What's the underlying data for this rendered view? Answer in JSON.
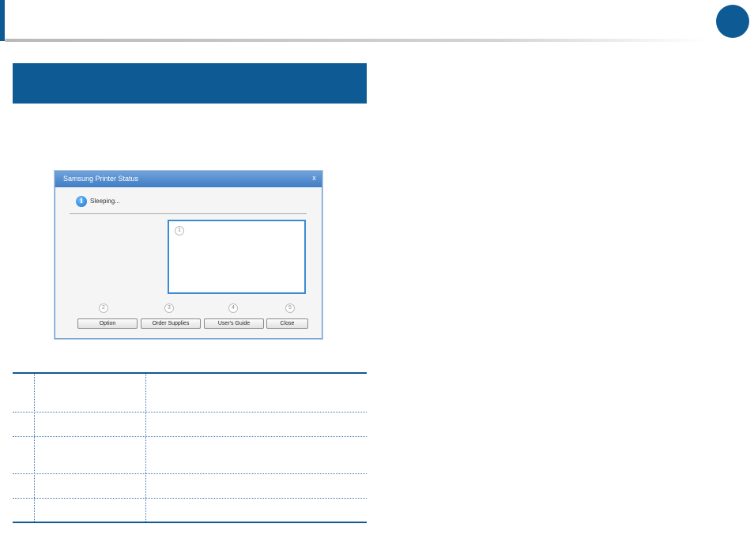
{
  "dialog": {
    "title": "Samsung Printer Status",
    "close_glyph": "x",
    "status_icon_glyph": "i",
    "status_text": "Sleeping...",
    "callouts": [
      "1",
      "2",
      "3",
      "4",
      "5"
    ],
    "buttons": {
      "option": "Option",
      "order_supplies": "Order Supplies",
      "users_guide": "User's Guide",
      "close": "Close"
    }
  },
  "colors": {
    "brand_blue": "#0e5a94",
    "dialog_title_blue": "#3f7cc3",
    "message_border": "#3c8bd2"
  },
  "table": {
    "rows": 5,
    "columns": 3
  }
}
